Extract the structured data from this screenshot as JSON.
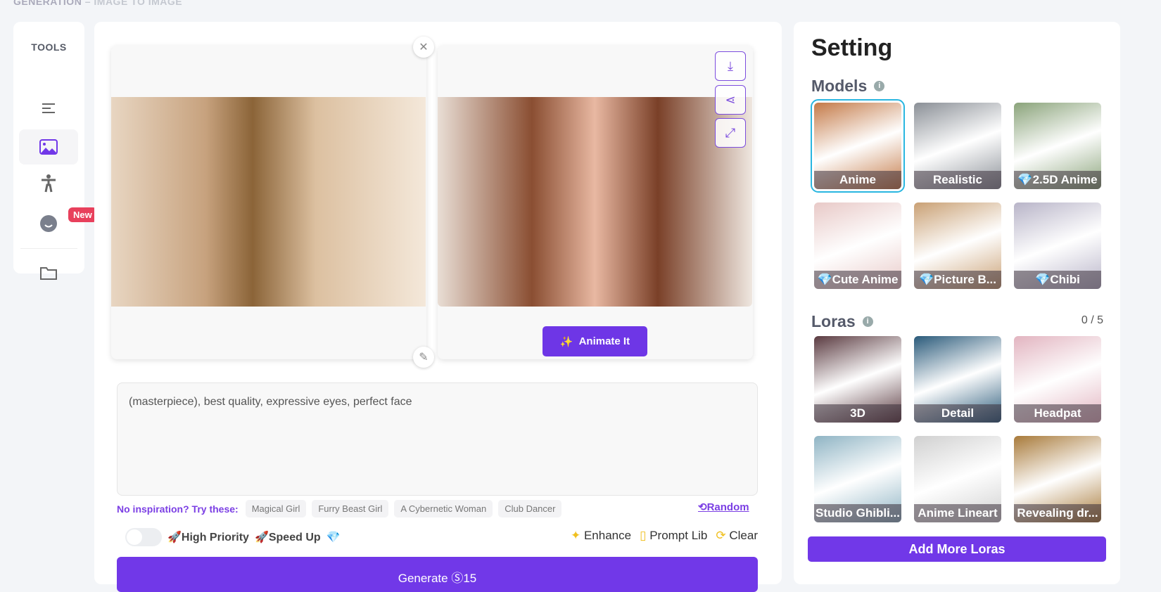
{
  "breadcrumb": {
    "section": "GENERATION",
    "sep": "–",
    "page": "IMAGE TO IMAGE"
  },
  "tools": {
    "title": "TOOLS",
    "items": [
      {
        "icon": "text-icon"
      },
      {
        "icon": "image-icon",
        "active": true
      },
      {
        "icon": "pose-icon"
      },
      {
        "icon": "face-icon",
        "badge": "New"
      },
      {
        "icon": "folder-icon"
      }
    ]
  },
  "editor": {
    "animate_label": "Animate It",
    "prompt": "(masterpiece), best quality, expressive eyes, perfect face",
    "inspiration_label": "No inspiration? Try these:",
    "suggestions": [
      "Magical Girl",
      "Furry Beast Girl",
      "A Cybernetic Woman",
      "Club Dancer"
    ],
    "random_label": "Random",
    "high_priority": "🚀High Priority",
    "speed_up": "🚀Speed Up",
    "gem": "💎",
    "enhance": "Enhance",
    "prompt_lib": "Prompt Lib",
    "clear": "Clear",
    "generate_label": "Generate",
    "generate_cost": "15"
  },
  "settings": {
    "title": "Setting",
    "models_label": "Models",
    "loras_label": "Loras",
    "loras_count": "0 / 5",
    "add_loras": "Add More Loras",
    "models": [
      {
        "name": "Anime",
        "premium": false,
        "selected": true,
        "color": "#c47a48"
      },
      {
        "name": "Realistic",
        "premium": false,
        "color": "#8a8f96"
      },
      {
        "name": "2.5D Anime",
        "premium": true,
        "color": "#8aa37a"
      },
      {
        "name": "Cute Anime",
        "premium": true,
        "color": "#e8c9c7"
      },
      {
        "name": "Picture B...",
        "premium": true,
        "color": "#c9a074"
      },
      {
        "name": "Chibi",
        "premium": true,
        "color": "#b8b4c8"
      }
    ],
    "loras": [
      {
        "name": "3D",
        "color": "#5a3a40"
      },
      {
        "name": "Detail",
        "color": "#2a5a7a"
      },
      {
        "name": "Headpat",
        "color": "#e2b4c0"
      },
      {
        "name": "Studio Ghibli...",
        "color": "#8fb4c4"
      },
      {
        "name": "Anime Lineart",
        "color": "#d0d0d0"
      },
      {
        "name": "Revealing dr...",
        "color": "#a87a3a"
      }
    ]
  }
}
